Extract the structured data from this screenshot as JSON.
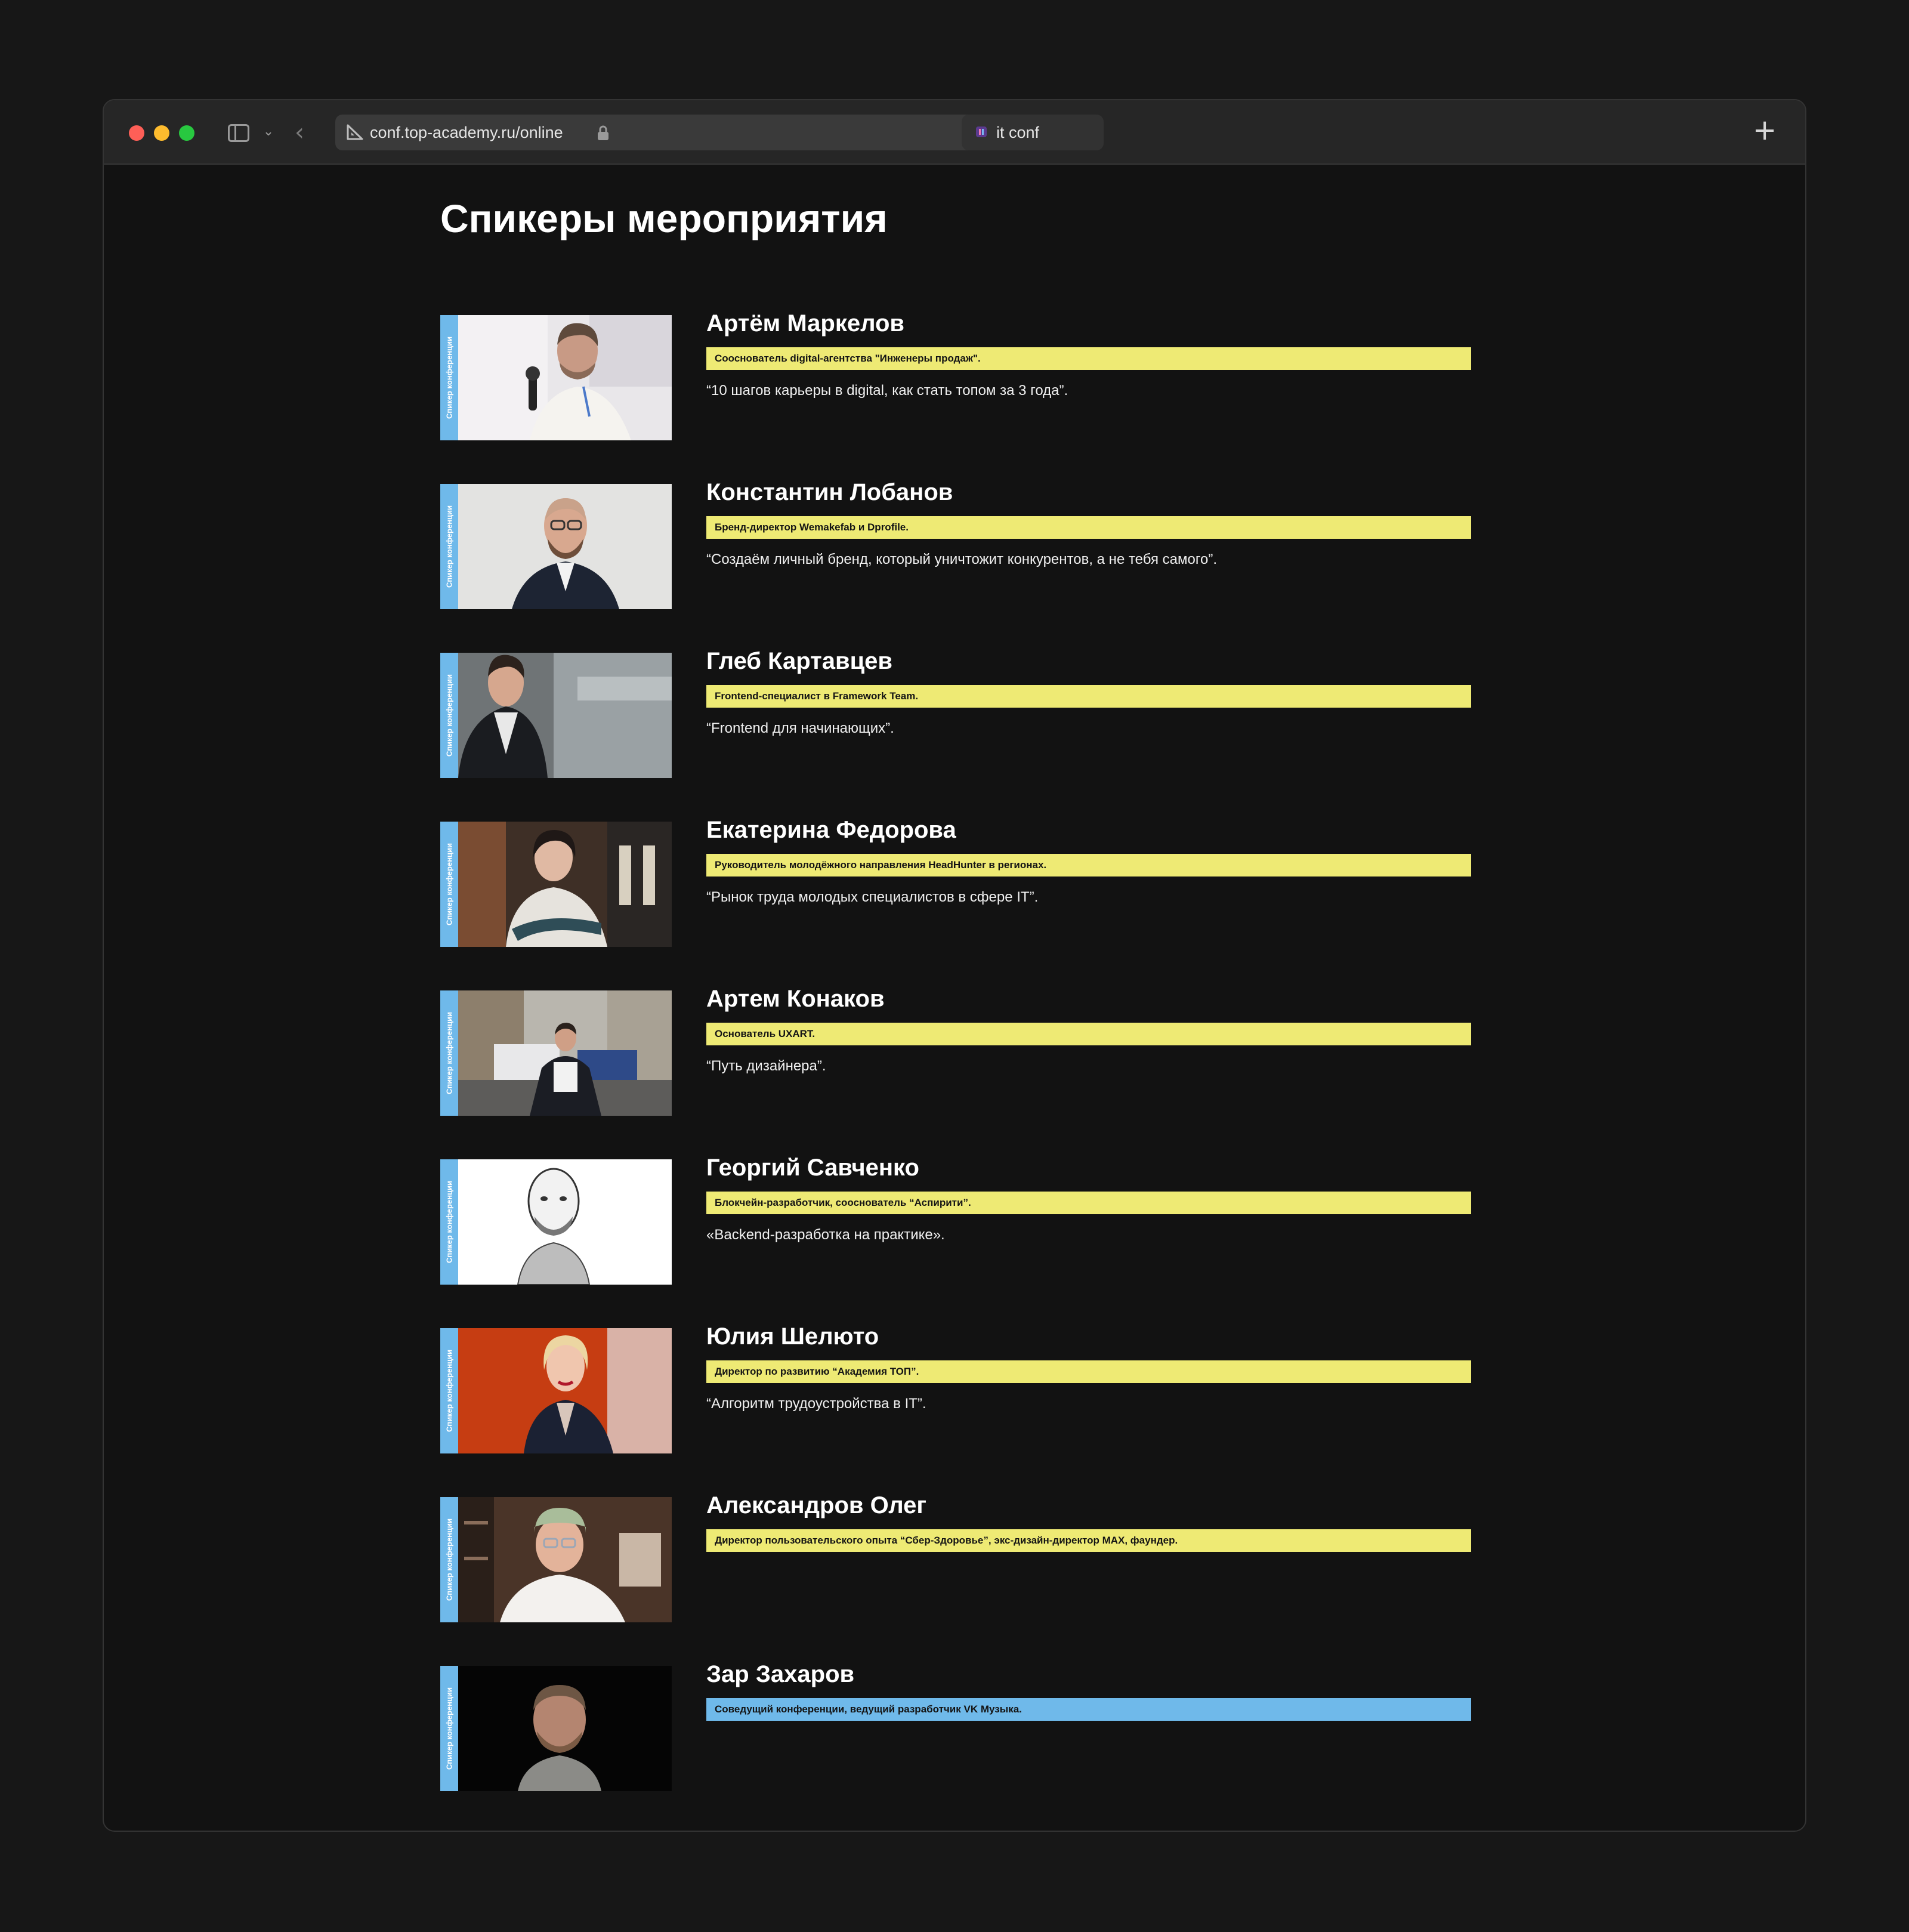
{
  "browser": {
    "url": "conf.top-academy.ru/online",
    "tab_title": "it conf"
  },
  "page": {
    "title": "Спикеры мероприятия",
    "photo_caption": "Спикер конференции"
  },
  "speakers": [
    {
      "name": "Артём Маркелов",
      "role": "Сооснователь digital-агентства \"Инженеры продаж\".",
      "talk": "“10 шагов карьеры в digital, как стать топом за 3 года”.",
      "role_color": "#eeea74"
    },
    {
      "name": "Константин Лобанов",
      "role": "Бренд-директор Wemakefab и Dprofile.",
      "talk": "“Создаём личный бренд, который уничтожит конкурентов, а не тебя самого”.",
      "role_color": "#eeea74"
    },
    {
      "name": "Глеб Картавцев",
      "role": "Frontend-специалист в Framework Team.",
      "talk": "“Frontend для начинающих”.",
      "role_color": "#eeea74"
    },
    {
      "name": "Екатерина Федорова",
      "role": "Руководитель молодёжного направления HeadHunter в регионах.",
      "talk": "“Рынок труда молодых специалистов в сфере IT”.",
      "role_color": "#eeea74"
    },
    {
      "name": "Артем Конаков",
      "role": "Основатель UXART.",
      "talk": "“Путь дизайнера”.",
      "role_color": "#eeea74"
    },
    {
      "name": "Георгий Савченко",
      "role": "Блокчейн-разработчик, сооснователь “Аспирити”.",
      "talk": "«Backend-разработка на практике».",
      "role_color": "#eeea74"
    },
    {
      "name": "Юлия Шелюто",
      "role": "Директор по развитию “Академия ТОП”.",
      "talk": "“Алгоритм трудоустройства в IT”.",
      "role_color": "#eeea74"
    },
    {
      "name": "Александров Олег",
      "role": "Директор пользовательского опыта “Сбер-Здоровье”, экс-дизайн-директор MAX, фаундер.",
      "talk": "",
      "role_color": "#eeea74"
    },
    {
      "name": "Зар Захаров",
      "role": "Соведущий конференции, ведущий разработчик VK Музыка.",
      "talk": "",
      "role_color": "#6fb9ea"
    }
  ]
}
